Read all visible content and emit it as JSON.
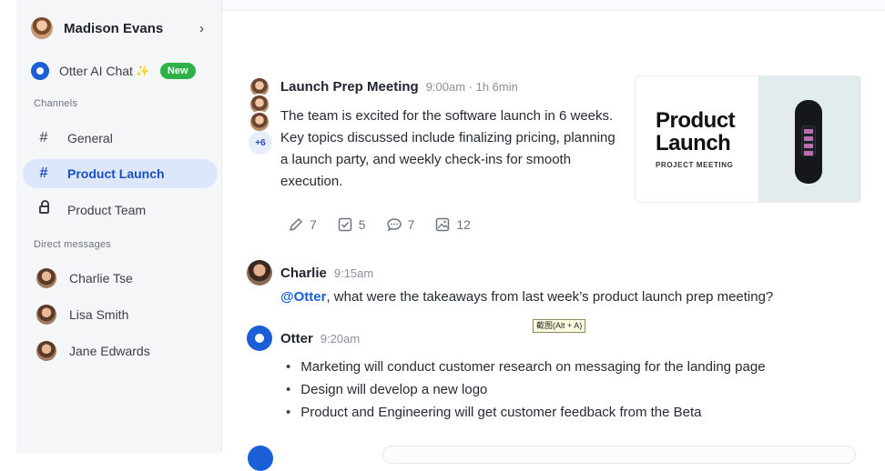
{
  "sidebar": {
    "user_name": "Madison Evans",
    "chevron": "›",
    "otter_chat_label": "Otter AI Chat",
    "otter_chat_badge": "New",
    "channels_heading": "Channels",
    "channels": [
      {
        "label": "General",
        "icon": "hash-icon"
      },
      {
        "label": "Product Launch",
        "icon": "hash-icon",
        "active": true
      },
      {
        "label": "Product Team",
        "icon": "lock-icon"
      }
    ],
    "dm_heading": "Direct messages",
    "direct_messages": [
      {
        "label": "Charlie Tse"
      },
      {
        "label": "Lisa Smith"
      },
      {
        "label": "Jane Edwards"
      }
    ]
  },
  "meeting": {
    "title": "Launch Prep Meeting",
    "time": "9:00am · 1h 6min",
    "extra_participants": "+6",
    "summary": "The team is excited for the software launch in 6 weeks. Key topics discussed include finalizing pricing, planning a launch party, and weekly check-ins for smooth execution.",
    "stats": {
      "edits": "7",
      "tasks": "5",
      "comments": "7",
      "images": "12"
    },
    "thumbnail": {
      "title_line1": "Product",
      "title_line2": "Launch",
      "subtitle": "PROJECT MEETING"
    }
  },
  "charlie_message": {
    "name": "Charlie",
    "time": "9:15am",
    "mention": "@Otter",
    "text": ", what were the takeaways from last week’s product launch prep meeting?"
  },
  "tooltip": "截图(Alt + A)",
  "otter_message": {
    "name": "Otter",
    "time": "9:20am",
    "bullets": [
      "Marketing will conduct customer research on messaging for the landing page",
      "Design will develop a new logo",
      "Product and Engineering will get customer feedback from the Beta"
    ]
  },
  "colors": {
    "accent": "#1a5fd6",
    "active_bg": "#dde7fb",
    "badge_green": "#2fb14a"
  }
}
